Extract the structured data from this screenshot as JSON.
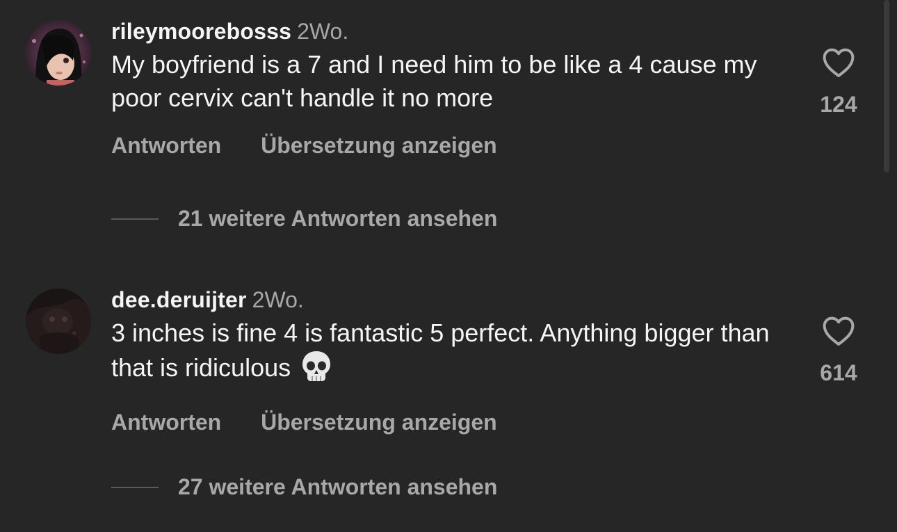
{
  "comments": [
    {
      "username": "rileymoorebosss",
      "time": "2Wo.",
      "text": "My boyfriend is a 7 and I need him to be like a 4 cause my poor cervix can't handle it no more",
      "reply_label": "Antworten",
      "translate_label": "Übersetzung anzeigen",
      "view_replies_label": "21 weitere Antworten ansehen",
      "like_count": "124",
      "like_icon": "heart-outline-icon"
    },
    {
      "username": "dee.deruijter",
      "time": "2Wo.",
      "text": "3 inches is fine 4 is fantastic 5 perfect. Anything bigger than that is ridiculous",
      "emoji": "skull-emoji",
      "reply_label": "Antworten",
      "translate_label": "Übersetzung anzeigen",
      "view_replies_label": "27 weitere Antworten ansehen",
      "like_count": "614",
      "like_icon": "heart-outline-icon"
    }
  ],
  "colors": {
    "background": "#262626",
    "primary_text": "#f5f5f5",
    "secondary_text": "#a8a8a8"
  }
}
